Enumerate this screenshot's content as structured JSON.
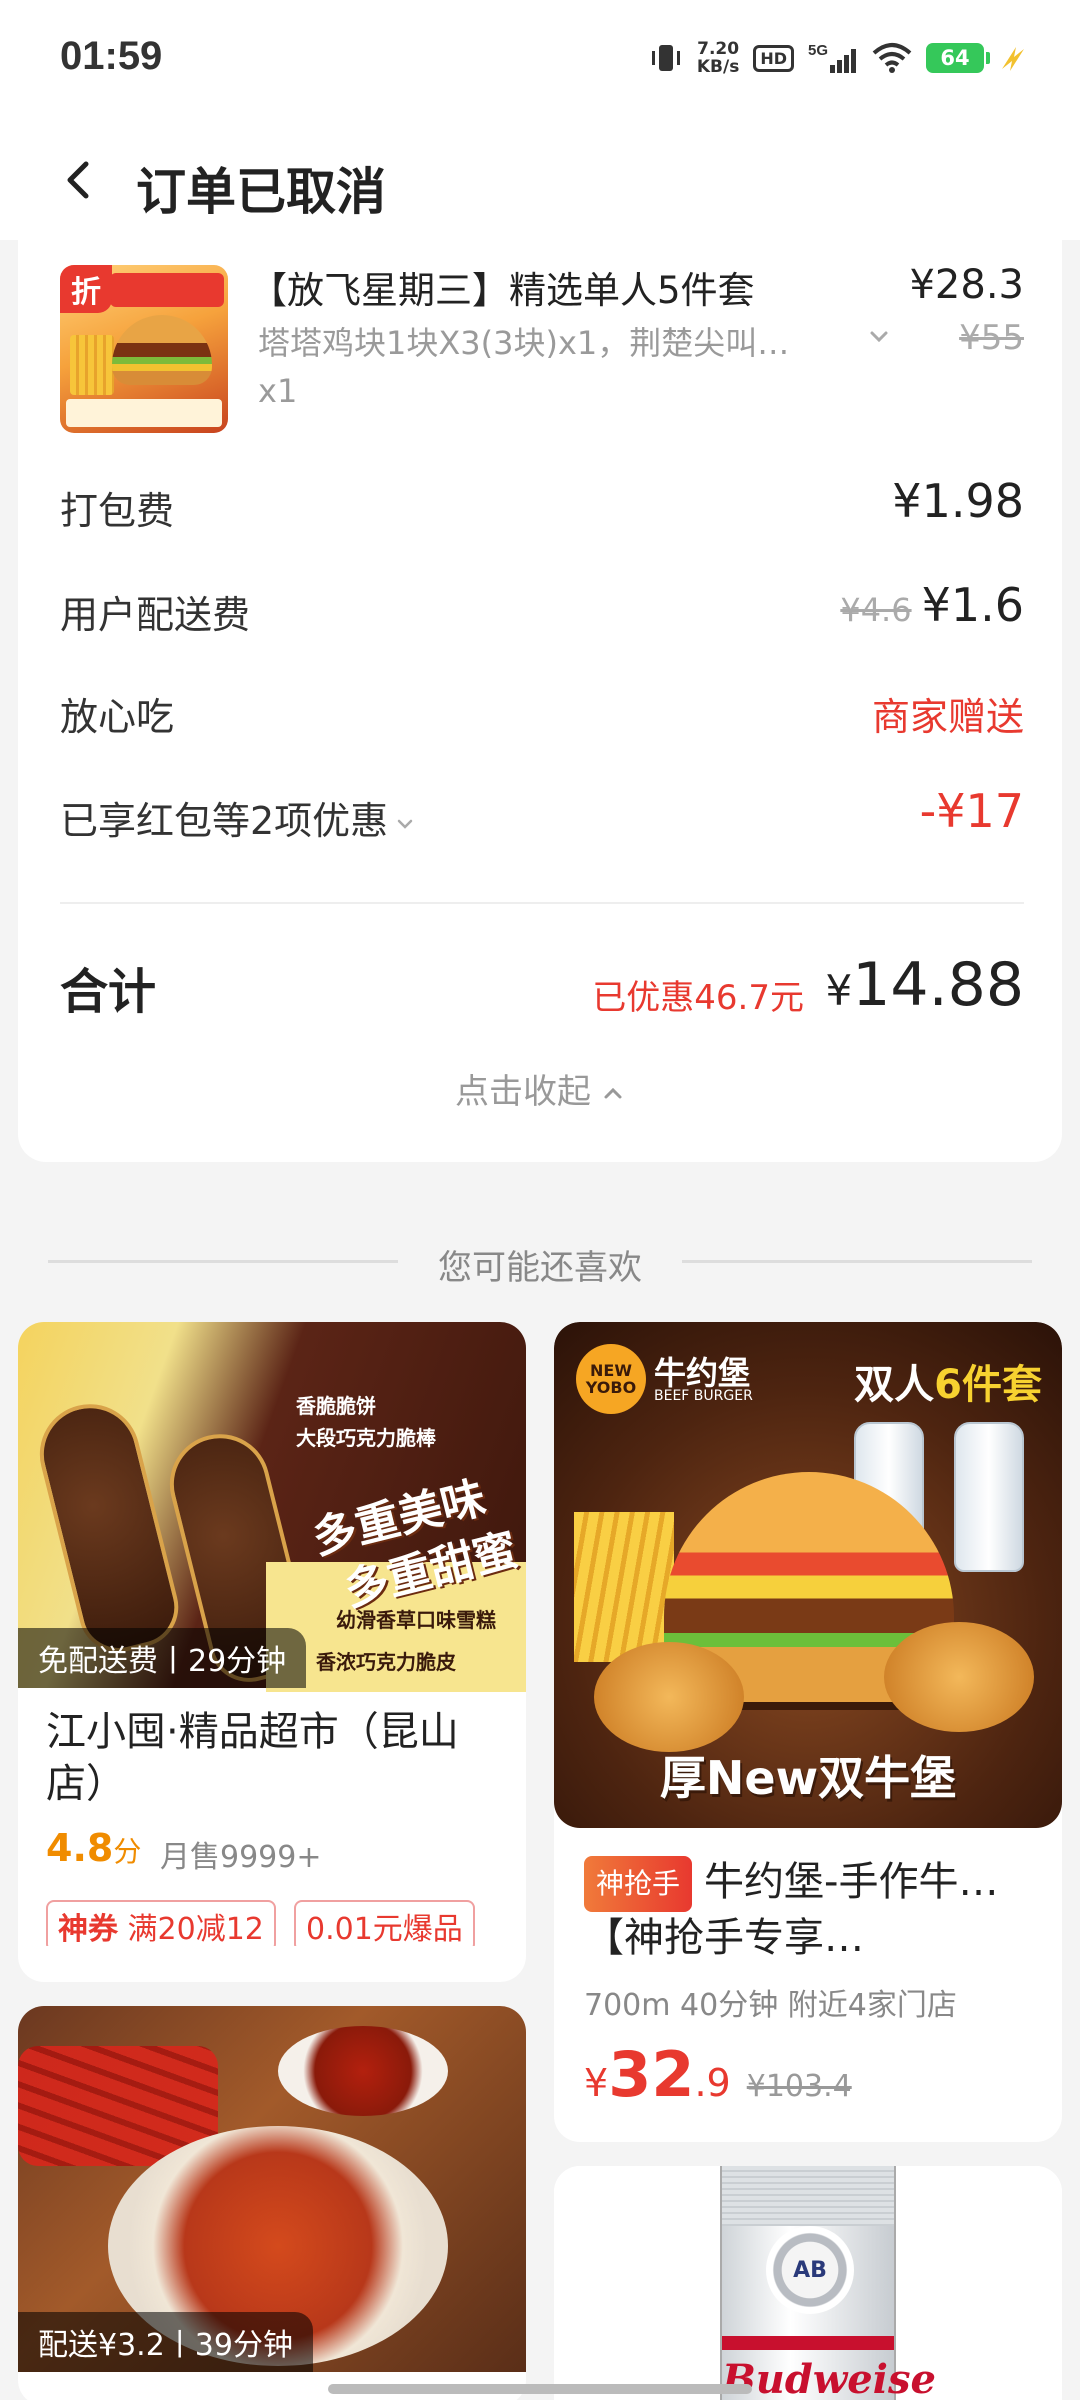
{
  "status_bar": {
    "time": "01:59",
    "net_speed_value": "7.20",
    "net_speed_unit": "KB/s",
    "hd": "HD",
    "network": "5G",
    "battery": "64"
  },
  "nav": {
    "title": "订单已取消"
  },
  "order": {
    "item": {
      "name": "【放飞星期三】精选单人5件套",
      "desc": "塔塔鸡块1块X3(3块)x1，荆楚尖叫…",
      "qty": "x1",
      "price": "¥28.3",
      "orig_price": "¥55",
      "discount_tag": "折"
    },
    "packing_fee": {
      "label": "打包费",
      "value": "¥1.98"
    },
    "delivery_fee": {
      "label": "用户配送费",
      "orig": "¥4.6",
      "value": "¥1.6"
    },
    "safe_eat": {
      "label": "放心吃",
      "value": "商家赠送"
    },
    "discounts": {
      "label": "已享红包等2项优惠",
      "value": "-¥17"
    },
    "total": {
      "label": "合计",
      "saved": "已优惠46.7元",
      "currency": "¥",
      "value": "14.88"
    },
    "collapse_label": "点击收起"
  },
  "recommend": {
    "title": "您可能还喜欢",
    "cards": [
      {
        "badge": "免配送费丨29分钟",
        "name": "江小囤·精品超市（昆山店）",
        "rating": "4.8",
        "rating_unit": "分",
        "sales": "月售9999+",
        "coupons": [
          {
            "tag": "神券",
            "text": "满20减12"
          },
          {
            "text": "0.01元爆品"
          }
        ],
        "img_text": {
          "line1": "多重美味",
          "line2": "多重甜蜜",
          "s1": "香脆脆饼",
          "s2": "大段巧克力脆棒",
          "s3": "幼滑香草口味雪糕",
          "s4": "香浓巧克力脆皮"
        }
      },
      {
        "flash": "神抢手",
        "name": "牛约堡-手作牛…【神抢手专享…",
        "distance": "700m 40分钟 附近4家门店",
        "price_currency": "¥",
        "price_int": "32",
        "price_dec": ".9",
        "orig_price": "¥103.4",
        "img_text": {
          "logo": "NEW YOBO",
          "brand": "牛约堡",
          "brand_sub": "BEEF BURGER",
          "set_prefix": "双人",
          "set_num": "6",
          "set_suffix": "件套",
          "bottom": "厚New双牛堡"
        }
      },
      {
        "badge": "配送¥3.2丨39分钟"
      },
      {
        "img_text": {
          "emblem": "AB",
          "brand": "Budweise"
        }
      }
    ]
  },
  "colors": {
    "accent_red": "#e8392f",
    "rating_orange": "#f08c00",
    "battery_green": "#35c85a"
  }
}
